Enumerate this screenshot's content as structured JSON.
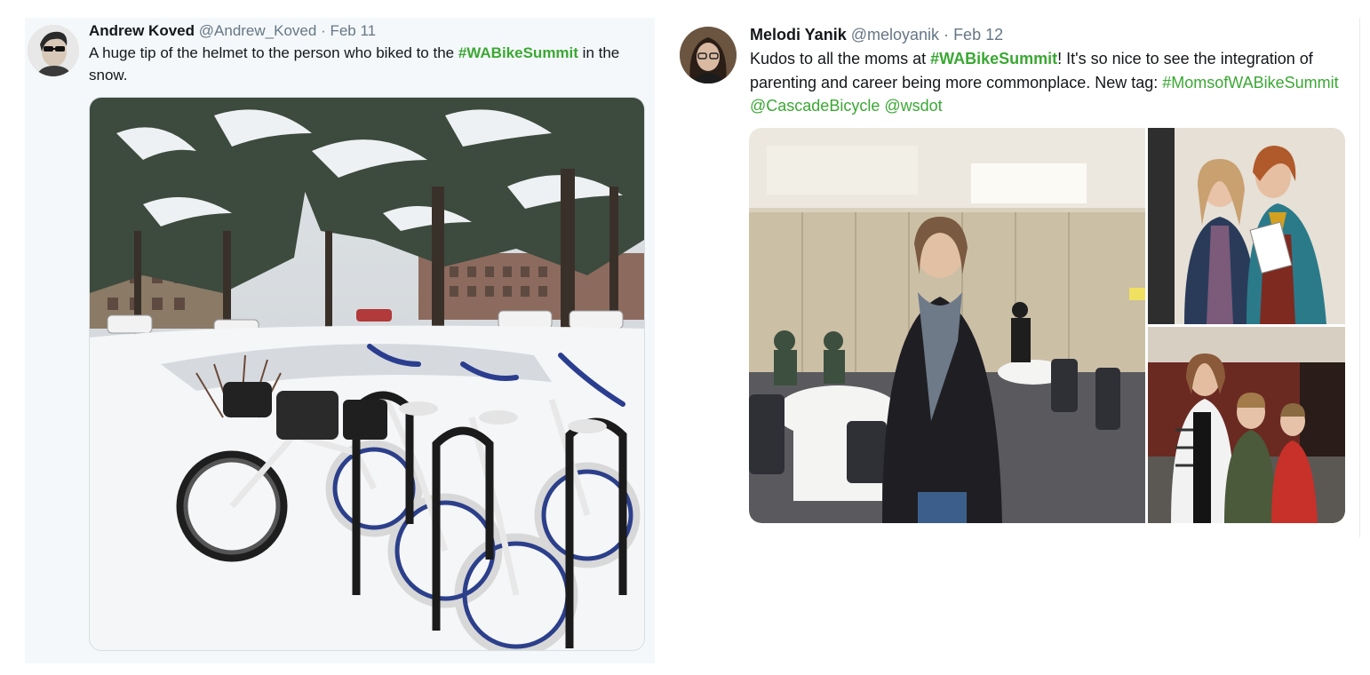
{
  "tweets": [
    {
      "author_name": "Andrew Koved",
      "handle": "@Andrew_Koved",
      "separator": "·",
      "date": "Feb 11",
      "text_before": "A huge tip of the helmet to the person who biked to the ",
      "hashtag": "#WABikeSummit",
      "text_after": " in the snow.",
      "avatar_icon": "profile-photo-sunglasses",
      "image_icon": "photo-snowy-bike-rack"
    },
    {
      "author_name": "Melodi Yanik",
      "handle": "@meloyanik",
      "separator": "·",
      "date": "Feb 12",
      "text_before": "Kudos to all the moms at ",
      "hashtag": "#WABikeSummit",
      "text_after": "! It's so nice to see the integration of parenting and career being more commonplace. New tag: ",
      "hashtag2": "#MomsofWABikeSummit",
      "mention1": "@CascadeBicycle",
      "mention2": "@wsdot",
      "avatar_icon": "profile-photo-woman",
      "images": [
        "photo-woman-conference-room",
        "photo-two-women-smiling",
        "photo-mother-with-children"
      ]
    }
  ],
  "colors": {
    "link": "#3aa833",
    "meta": "#657786",
    "text": "#14171a"
  }
}
